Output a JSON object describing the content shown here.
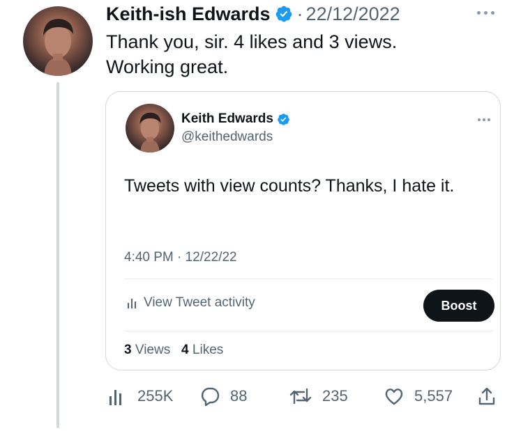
{
  "tweet": {
    "author_name": "Keith-ish Edwards",
    "separator": "·",
    "date": "22/12/2022",
    "text": "Thank you, sir. 4 likes and 3 views. Working great."
  },
  "quote": {
    "author_name": "Keith Edwards",
    "handle": "@keithedwards",
    "text": "Tweets with view counts? Thanks, I hate it.",
    "timestamp": "4:40 PM · 12/22/22",
    "activity_label": "View Tweet activity",
    "boost_label": "Boost",
    "views_count": "3",
    "views_label": "Views",
    "likes_count": "4",
    "likes_label": "Likes"
  },
  "actions": {
    "views": "255K",
    "replies": "88",
    "retweets": "235",
    "likes": "5,557"
  },
  "colors": {
    "verified": "#1d9bf0",
    "text_primary": "#0f1419",
    "text_secondary": "#536471",
    "border": "#cfd9de",
    "button_bg": "#0f1419"
  },
  "icons": [
    "verified-badge-icon",
    "more-icon",
    "analytics-icon",
    "reply-icon",
    "retweet-icon",
    "like-icon",
    "share-icon"
  ]
}
